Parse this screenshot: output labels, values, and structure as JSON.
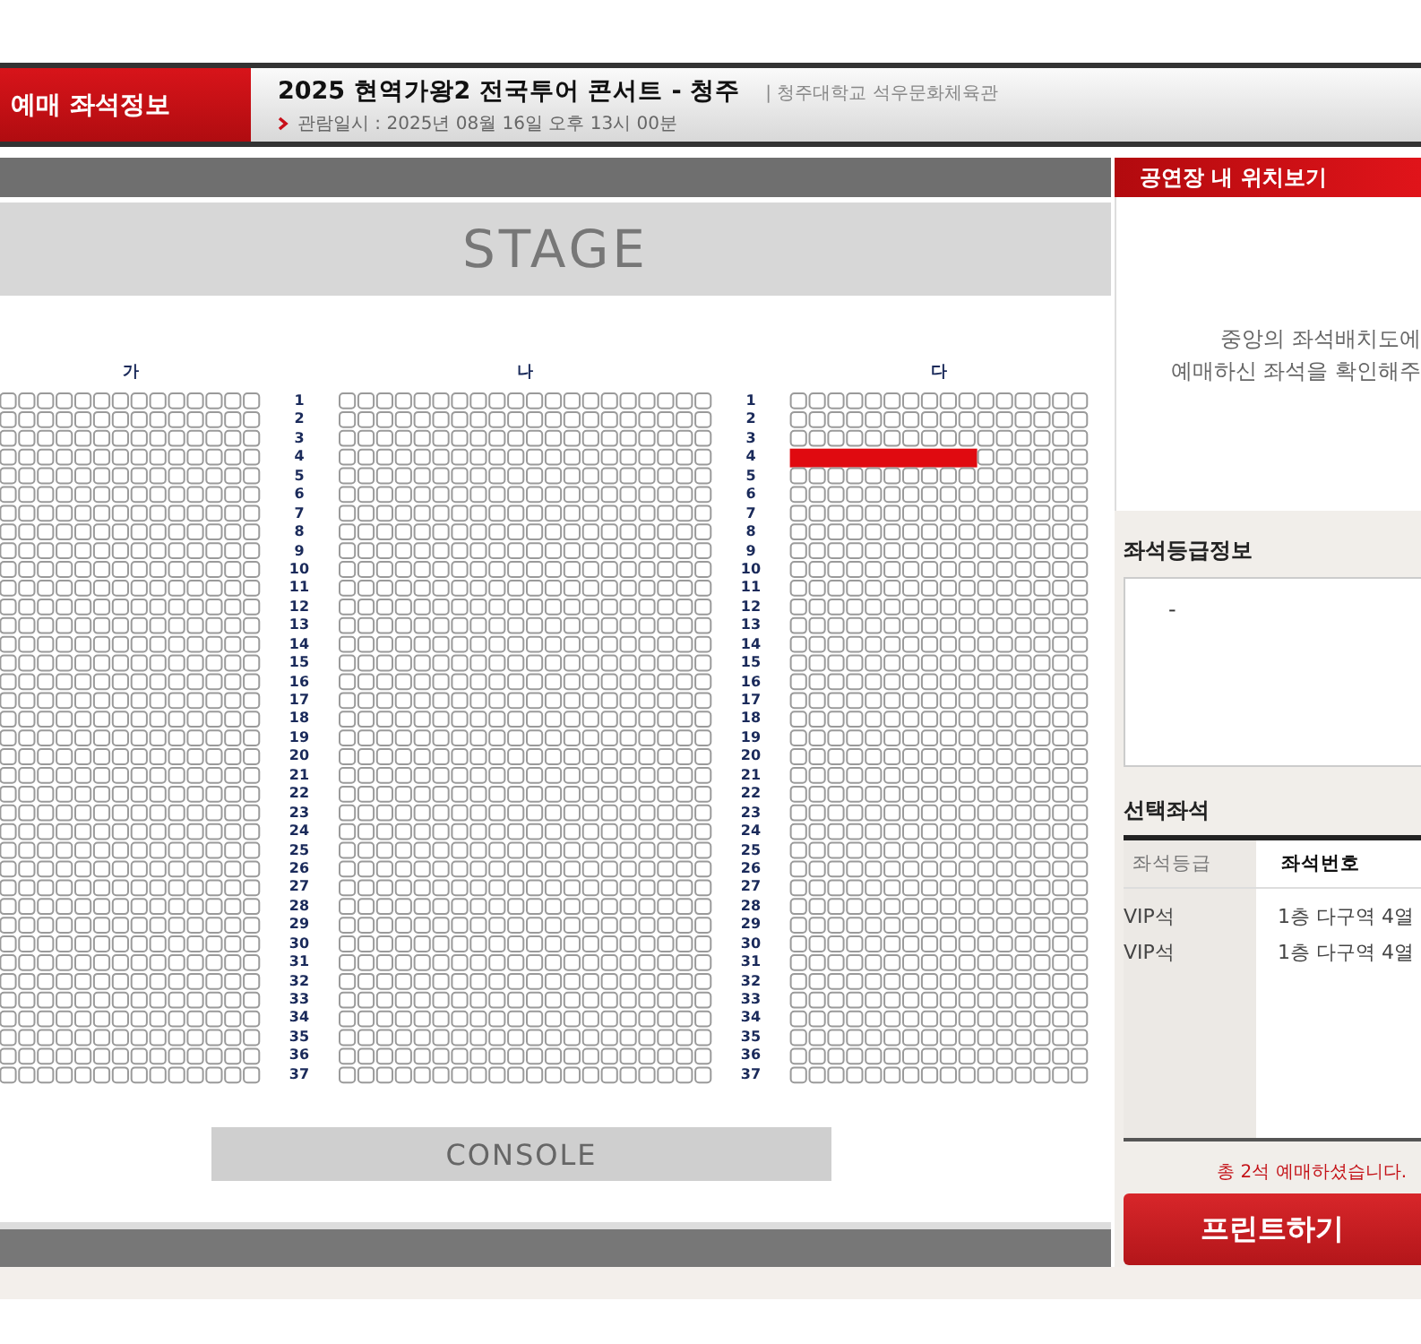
{
  "header": {
    "tab": "예매 좌석정보",
    "title": "2025 현역가왕2 전국투어 콘서트 - 청주",
    "venue": "| 청주대학교 석우문화체육관",
    "date": "관람일시 : 2025년 08월 16일 오후 13시 00분"
  },
  "seat_map": {
    "stage": "STAGE",
    "console": "CONSOLE",
    "sections": [
      {
        "label": "가"
      },
      {
        "label": "나"
      },
      {
        "label": "다"
      }
    ],
    "rows": [
      {
        "numbers": [
          "1",
          "1"
        ],
        "selected": [
          false,
          false,
          false
        ]
      },
      {
        "numbers": [
          "2",
          "2"
        ],
        "selected": [
          false,
          false,
          false
        ]
      },
      {
        "numbers": [
          "3",
          "3"
        ],
        "selected": [
          false,
          false,
          false
        ]
      },
      {
        "numbers": [
          "4",
          "4"
        ],
        "selected": [
          false,
          false,
          true
        ]
      },
      {
        "numbers": [
          "5",
          "5"
        ],
        "selected": [
          false,
          false,
          false
        ]
      },
      {
        "numbers": [
          "6",
          "6"
        ],
        "selected": [
          false,
          false,
          false
        ]
      },
      {
        "numbers": [
          "7",
          "7"
        ],
        "selected": [
          false,
          false,
          false
        ]
      },
      {
        "numbers": [
          "8",
          "8"
        ],
        "selected": [
          false,
          false,
          false
        ]
      },
      {
        "numbers": [
          "9",
          "9"
        ],
        "selected": [
          false,
          false,
          false
        ]
      },
      {
        "numbers": [
          "10",
          "10"
        ],
        "selected": [
          false,
          false,
          false
        ]
      },
      {
        "numbers": [
          "11",
          "11"
        ],
        "selected": [
          false,
          false,
          false
        ]
      },
      {
        "numbers": [
          "12",
          "12"
        ],
        "selected": [
          false,
          false,
          false
        ]
      },
      {
        "numbers": [
          "13",
          "13"
        ],
        "selected": [
          false,
          false,
          false
        ]
      },
      {
        "numbers": [
          "14",
          "14"
        ],
        "selected": [
          false,
          false,
          false
        ]
      },
      {
        "numbers": [
          "15",
          "15"
        ],
        "selected": [
          false,
          false,
          false
        ]
      },
      {
        "numbers": [
          "16",
          "16"
        ],
        "selected": [
          false,
          false,
          false
        ]
      },
      {
        "numbers": [
          "17",
          "17"
        ],
        "selected": [
          false,
          false,
          false
        ]
      },
      {
        "numbers": [
          "18",
          "18"
        ],
        "selected": [
          false,
          false,
          false
        ]
      },
      {
        "numbers": [
          "19",
          "19"
        ],
        "selected": [
          false,
          false,
          false
        ]
      },
      {
        "numbers": [
          "20",
          "20"
        ],
        "selected": [
          false,
          false,
          false
        ]
      },
      {
        "numbers": [
          "21",
          "21"
        ],
        "selected": [
          false,
          false,
          false
        ]
      },
      {
        "numbers": [
          "22",
          "22"
        ],
        "selected": [
          false,
          false,
          false
        ]
      },
      {
        "numbers": [
          "23",
          "23"
        ],
        "selected": [
          false,
          false,
          false
        ]
      },
      {
        "numbers": [
          "24",
          "24"
        ],
        "selected": [
          false,
          false,
          false
        ]
      },
      {
        "numbers": [
          "25",
          "25"
        ],
        "selected": [
          false,
          false,
          false
        ]
      },
      {
        "numbers": [
          "26",
          "26"
        ],
        "selected": [
          false,
          false,
          false
        ]
      },
      {
        "numbers": [
          "27",
          "27"
        ],
        "selected": [
          false,
          false,
          false
        ]
      },
      {
        "numbers": [
          "28",
          "28"
        ],
        "selected": [
          false,
          false,
          false
        ]
      },
      {
        "numbers": [
          "29",
          "29"
        ],
        "selected": [
          false,
          false,
          false
        ]
      },
      {
        "numbers": [
          "30",
          "30"
        ],
        "selected": [
          false,
          false,
          false
        ]
      },
      {
        "numbers": [
          "31",
          "31"
        ],
        "selected": [
          false,
          false,
          false
        ]
      },
      {
        "numbers": [
          "32",
          "32"
        ],
        "selected": [
          false,
          false,
          false
        ]
      },
      {
        "numbers": [
          "33",
          "33"
        ],
        "selected": [
          false,
          false,
          false
        ]
      },
      {
        "numbers": [
          "34",
          "34"
        ],
        "selected": [
          false,
          false,
          false
        ]
      },
      {
        "numbers": [
          "35",
          "35"
        ],
        "selected": [
          false,
          false,
          false
        ]
      },
      {
        "numbers": [
          "36",
          "36"
        ],
        "selected": [
          false,
          false,
          false
        ]
      },
      {
        "numbers": [
          "37",
          "37"
        ],
        "selected": [
          false,
          false,
          false
        ]
      }
    ]
  },
  "side": {
    "location_title": "공연장 내 위치보기",
    "location_hint": [
      "중앙의 좌석배치도에",
      "예매하신 좌석을 확인해주"
    ],
    "grade_title": "좌석등급정보",
    "grade_info": "-",
    "selected_title": "선택좌석",
    "columns": [
      "좌석등급",
      "좌석번호"
    ],
    "seats": [
      {
        "grade": "VIP석",
        "number": "1층 다구역 4열"
      },
      {
        "grade": "VIP석",
        "number": "1층 다구역 4열"
      }
    ],
    "total": "총 2석 예매하셨습니다.",
    "print_button": "프린트하기"
  }
}
